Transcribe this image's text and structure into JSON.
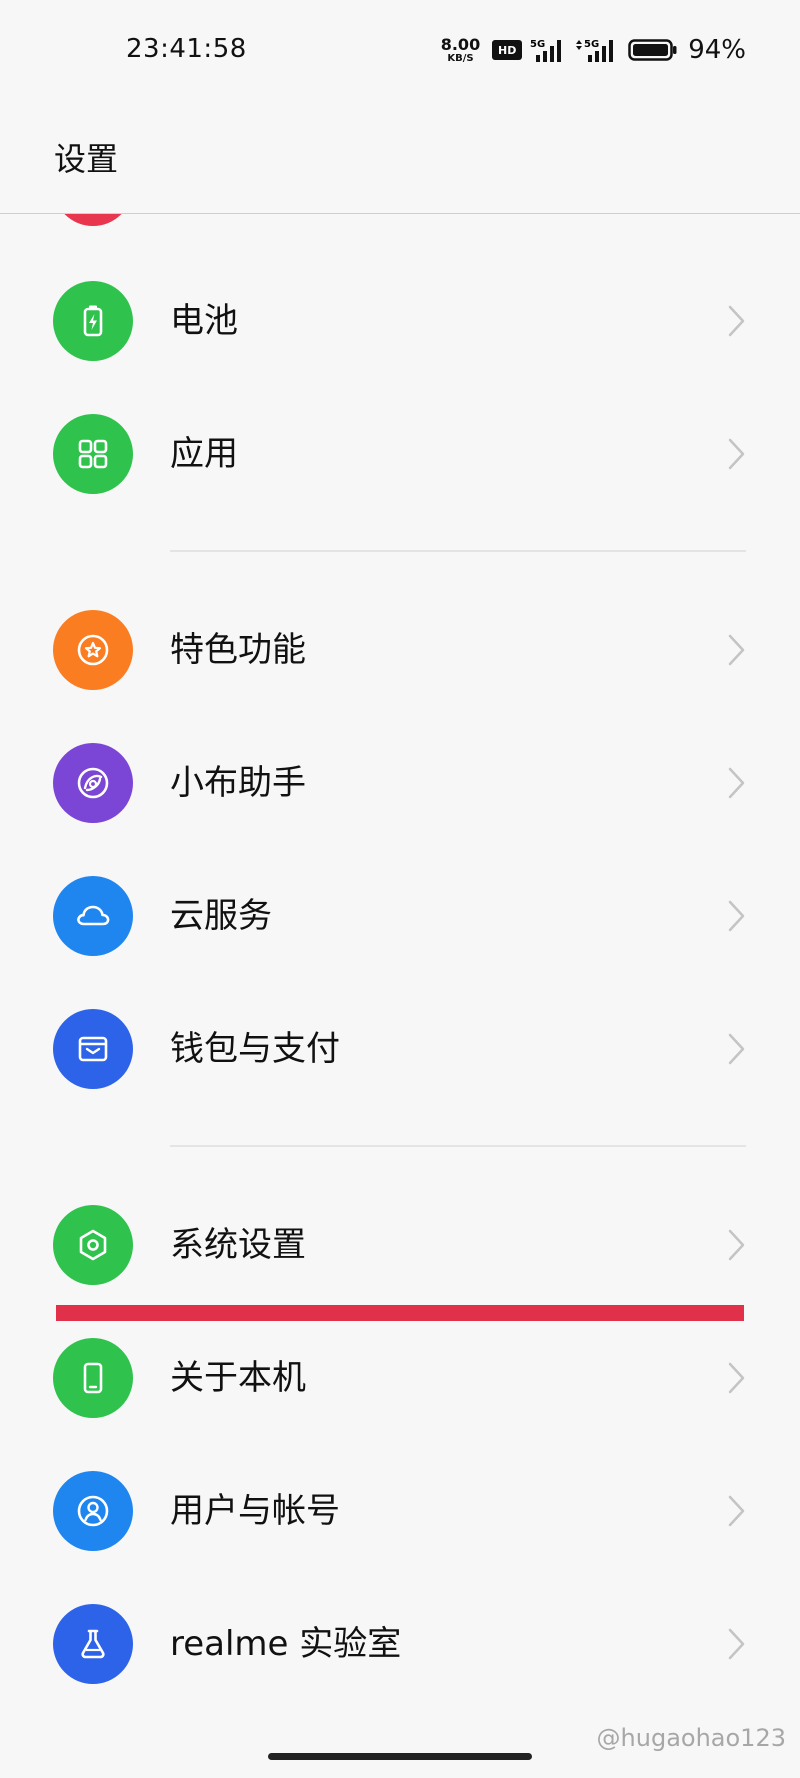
{
  "status_bar": {
    "time": "23:41:58",
    "net_speed_value": "8.00",
    "net_speed_unit": "KB/S",
    "hd_badge": "HD",
    "sim1_label": "5G",
    "sim2_label": "5G",
    "battery_percent": "94%"
  },
  "header": {
    "title": "设置"
  },
  "items": {
    "battery": {
      "label": "电池",
      "icon": "battery-icon",
      "color": "#2fc24c"
    },
    "apps": {
      "label": "应用",
      "icon": "apps-grid-icon",
      "color": "#2fc24c"
    },
    "features": {
      "label": "特色功能",
      "icon": "star-badge-icon",
      "color": "#fa7d22"
    },
    "assistant": {
      "label": "小布助手",
      "icon": "assistant-icon",
      "color": "#7b45d6"
    },
    "cloud": {
      "label": "云服务",
      "icon": "cloud-icon",
      "color": "#1f86f0"
    },
    "wallet": {
      "label": "钱包与支付",
      "icon": "wallet-icon",
      "color": "#2c63e8"
    },
    "system": {
      "label": "系统设置",
      "icon": "hexagon-settings-icon",
      "color": "#2fc24c"
    },
    "about": {
      "label": "关于本机",
      "icon": "phone-icon",
      "color": "#2fc24c"
    },
    "accounts": {
      "label": "用户与帐号",
      "icon": "user-icon",
      "color": "#1f86f0"
    },
    "lab": {
      "label": "realme 实验室",
      "icon": "flask-icon",
      "color": "#2c63e8"
    }
  },
  "colors": {
    "highlight_underline": "#e0304a",
    "partial_item_icon": "#e8364e"
  },
  "watermark": "@hugaohao123"
}
